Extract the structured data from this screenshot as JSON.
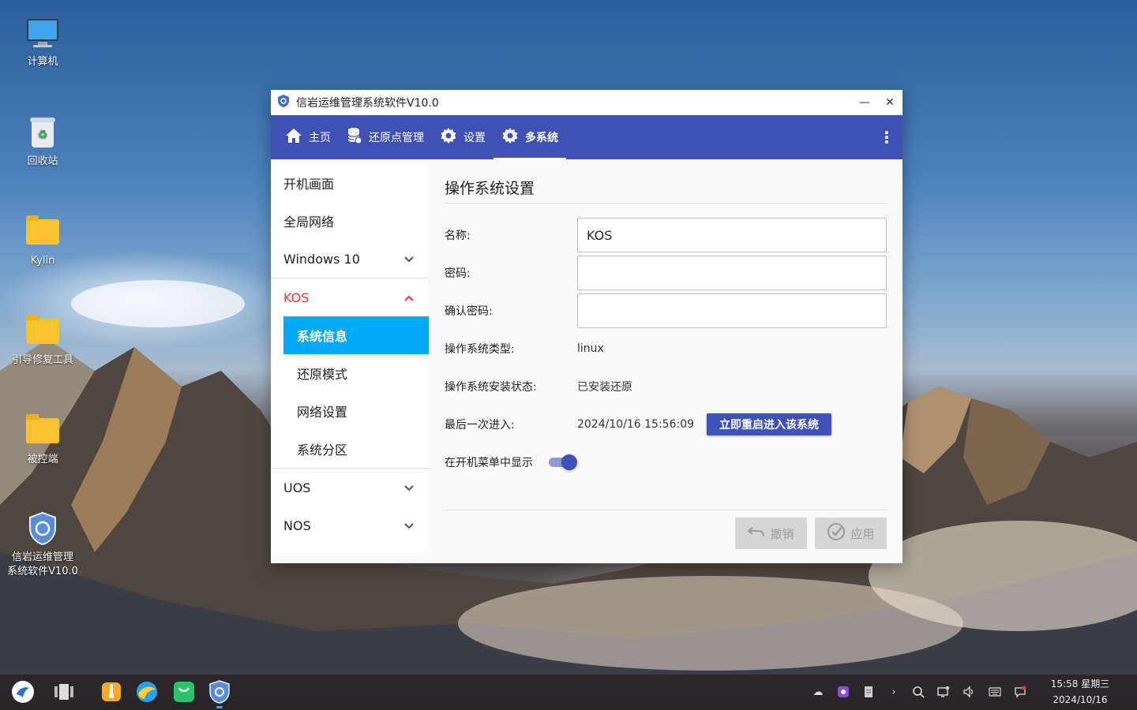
{
  "desktop": {
    "icons": [
      {
        "label": "计算机",
        "icon": "computer-icon"
      },
      {
        "label": "回收站",
        "icon": "trash-icon"
      },
      {
        "label": "Kylin",
        "icon": "home-folder-icon"
      },
      {
        "label": "引导修复工具",
        "icon": "folder-icon"
      },
      {
        "label": "被控端",
        "icon": "folder-icon"
      },
      {
        "label_line1": "信岩运维管理",
        "label_line2": "系统软件V10.0",
        "icon": "shield-app-icon"
      }
    ]
  },
  "window": {
    "title": "信岩运维管理系统软件V10.0",
    "minimize": "—",
    "close": "✕",
    "nav": [
      {
        "label": "主页",
        "icon": "home-icon"
      },
      {
        "label": "还原点管理",
        "icon": "database-icon"
      },
      {
        "label": "设置",
        "icon": "gear-icon"
      },
      {
        "label": "多系统",
        "icon": "gear-icon",
        "active": true
      }
    ],
    "more_icon": "⋮",
    "sidebar": {
      "items": [
        {
          "label": "开机画面"
        },
        {
          "label": "全局网络"
        },
        {
          "label": "Windows 10"
        },
        {
          "label": "KOS"
        },
        {
          "label": "UOS"
        },
        {
          "label": "NOS"
        }
      ],
      "kos_sub": [
        {
          "label": "系统信息",
          "selected": true
        },
        {
          "label": "还原模式"
        },
        {
          "label": "网络设置"
        },
        {
          "label": "系统分区"
        }
      ]
    },
    "main": {
      "section_title": "操作系统设置",
      "name_label": "名称:",
      "name_value": "KOS",
      "password_label": "密码:",
      "password_value": "",
      "confirm_label": "确认密码:",
      "confirm_value": "",
      "os_type_label": "操作系统类型:",
      "os_type_value": "linux",
      "install_state_label": "操作系统安装状态:",
      "install_state_value": "已安装还原",
      "last_enter_label": "最后一次进入:",
      "last_enter_value": "2024/10/16 15:56:09",
      "restart_button": "立即重启进入该系统",
      "show_in_boot_label": "在开机菜单中显示",
      "show_in_boot_on": true,
      "undo_button": "撤销",
      "apply_button": "应用"
    }
  },
  "taskbar": {
    "time": "15:58 星期三",
    "date": "2024/10/16"
  },
  "colors": {
    "primary": "#3f51b5",
    "selected": "#03a9f4",
    "expanded_text": "#e53935"
  }
}
